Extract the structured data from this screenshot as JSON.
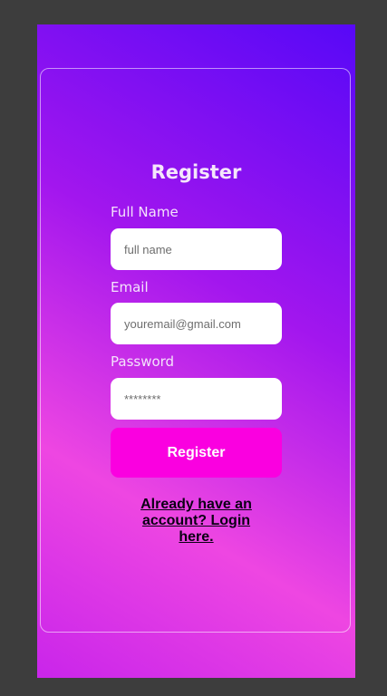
{
  "form": {
    "title": "Register",
    "full_name_label": "Full Name",
    "full_name_placeholder": "full name",
    "email_label": "Email",
    "email_placeholder": "youremail@gmail.com",
    "password_label": "Password",
    "password_placeholder": "********",
    "submit_label": "Register",
    "login_link": "Already have an account? Login here."
  },
  "colors": {
    "gradient_top": "#5708f7",
    "gradient_mid": "#a216ee",
    "gradient_bottom": "#ee46e2",
    "button": "#fa00e0",
    "page_background": "#3d3d3d"
  }
}
